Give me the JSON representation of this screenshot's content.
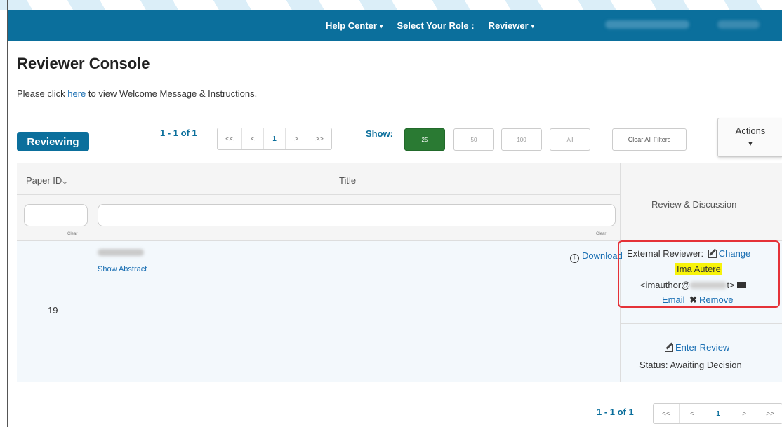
{
  "topbar": {
    "help_center": "Help Center",
    "select_role_label": "Select Your Role :",
    "role": "Reviewer",
    "color": "#0b6f9c"
  },
  "page": {
    "title": "Reviewer Console",
    "intro_prefix": "Please click ",
    "intro_link": "here",
    "intro_suffix": " to view Welcome Message & Instructions."
  },
  "toolbar": {
    "reviewing_label": "Reviewing",
    "count_text": "1 - 1 of 1",
    "pager": [
      "<<",
      "<",
      "1",
      ">",
      ">>"
    ],
    "show_label": "Show:",
    "show_options": [
      "25",
      "50",
      "100",
      "All"
    ],
    "show_selected": "25",
    "clear_filters": "Clear All Filters",
    "actions_label": "Actions"
  },
  "table": {
    "columns": [
      "Paper ID",
      "Title",
      "Review & Discussion"
    ],
    "clear_label": "Clear",
    "rows": [
      {
        "paper_id": "19",
        "show_abstract": "Show Abstract",
        "download": "Download",
        "external_reviewer_label": "External Reviewer:",
        "change_label": "Change",
        "reviewer_name": "Ima Autere",
        "reviewer_email_prefix": "<imauthor@",
        "reviewer_email_suffix": "t>",
        "email_label": "Email",
        "remove_label": "Remove",
        "enter_review": "Enter Review",
        "status": "Status: Awaiting Decision"
      }
    ]
  },
  "footer": {
    "count_text": "1 - 1 of 1",
    "pager": [
      "<<",
      "<",
      "1",
      ">",
      ">>"
    ]
  },
  "colors": {
    "brand": "#0b6f9c",
    "show_active": "#2a7a33",
    "highlight": "#f7f30a",
    "callout": "#e53238"
  }
}
